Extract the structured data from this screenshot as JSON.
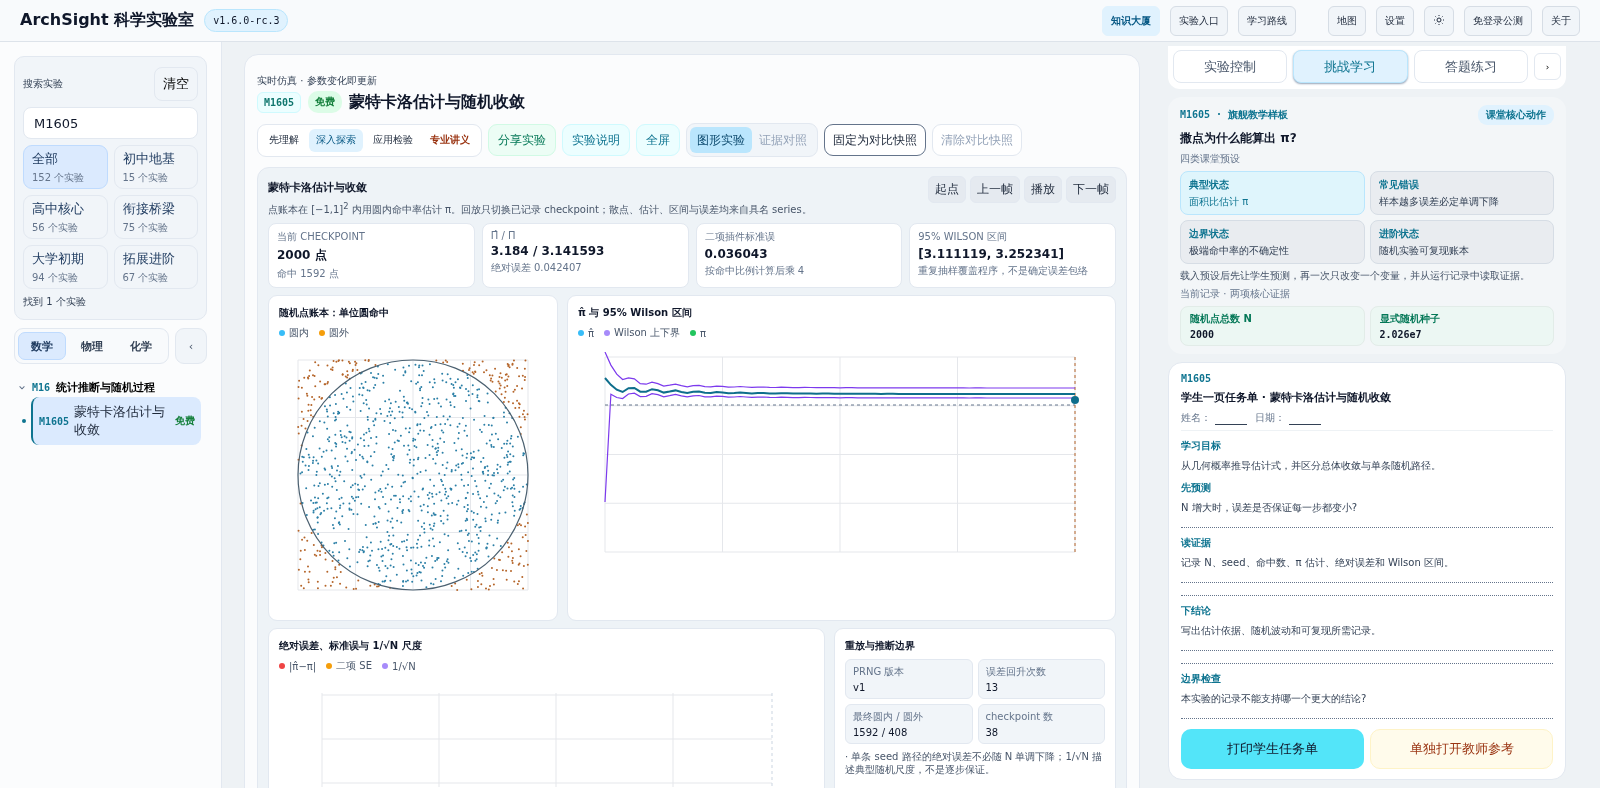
{
  "header": {
    "brand": "ArchSight 科学实验室",
    "version": "v1.6.0-rc.3",
    "nav": [
      {
        "label": "知识大厦",
        "selected": true
      },
      {
        "label": "实验入口",
        "selected": false
      },
      {
        "label": "学习路线",
        "selected": false
      }
    ],
    "tools": [
      {
        "kind": "text",
        "label": "地图"
      },
      {
        "kind": "text",
        "label": "设置"
      },
      {
        "kind": "theme"
      },
      {
        "kind": "text",
        "label": "免登录公测"
      },
      {
        "kind": "text",
        "label": "关于"
      }
    ]
  },
  "sidebar": {
    "search": {
      "label": "搜索实验",
      "clear": "清空",
      "value": "M1605"
    },
    "levels": [
      {
        "name": "全部",
        "count": "152 个实验",
        "selected": true
      },
      {
        "name": "初中地基",
        "count": "15 个实验",
        "selected": false
      },
      {
        "name": "高中核心",
        "count": "56 个实验",
        "selected": false
      },
      {
        "name": "衔接桥梁",
        "count": "75 个实验",
        "selected": false
      },
      {
        "name": "大学初期",
        "count": "94 个实验",
        "selected": false
      },
      {
        "name": "拓展进阶",
        "count": "67 个实验",
        "selected": false
      }
    ],
    "found": "找到 1 个实验",
    "subjects": [
      {
        "label": "数学",
        "selected": true
      },
      {
        "label": "物理",
        "selected": false
      },
      {
        "label": "化学",
        "selected": false
      }
    ],
    "collapse": "‹",
    "tree": [
      {
        "code": "M16",
        "title": "统计推断与随机过程",
        "expanded": true,
        "children": [
          {
            "code": "M1605",
            "title": "蒙特卡洛估计与收敛",
            "badge": "免费",
            "selected": true
          }
        ]
      }
    ]
  },
  "main": {
    "subtitle": "实时仿真 · 参数变化即更新",
    "code": "M1605",
    "badge": "免费",
    "title": "蒙特卡洛估计与随机收敛",
    "modes": [
      {
        "label": "先理解",
        "kind": "plain",
        "selected": false
      },
      {
        "label": "深入探索",
        "kind": "plain",
        "selected": true
      },
      {
        "label": "应用检验",
        "kind": "plain",
        "selected": false
      },
      {
        "label": "专业讲义",
        "kind": "pro",
        "selected": false
      }
    ],
    "actions": [
      {
        "label": "分享实验",
        "kind": "share"
      },
      {
        "label": "实验说明",
        "kind": "info"
      },
      {
        "label": "全屏",
        "kind": "info"
      }
    ],
    "views": [
      {
        "label": "图形实验",
        "selected": true
      },
      {
        "label": "证据对照",
        "selected": false
      }
    ],
    "snapshots": [
      {
        "label": "固定为对比快照",
        "disabled": false
      },
      {
        "label": "清除对比快照",
        "disabled": true
      }
    ],
    "sim": {
      "title": "蒙特卡洛估计与收敛",
      "description": "点账本在 [−1,1]$^{2}$ 内用圆内命中率估计 π。回放只切换已记录 checkpoint；散点、估计、区间与误差均来自具名 series。",
      "playback": [
        "起点",
        "上一帧",
        "播放",
        "下一帧"
      ],
      "stats": [
        {
          "label": "当前 CHECKPOINT",
          "value": "2000 点",
          "note": "命中 1592 点"
        },
        {
          "label": "Π̂ / Π",
          "value": "3.184 / 3.141593",
          "note": "绝对误差 0.042407"
        },
        {
          "label": "二项插件标准误",
          "value": "0.036043",
          "note": "按命中比例计算后乘 4"
        },
        {
          "label": "95% WILSON 区间",
          "value": "[3.111119, 3.252341]",
          "note": "重复抽样覆盖程序，不是确定误差包络"
        }
      ],
      "scatter": {
        "title": "随机点账本：单位圆命中",
        "legend": [
          {
            "label": "圆内",
            "color": "#38bdf8"
          },
          {
            "label": "圆外",
            "color": "#f59e0b"
          }
        ]
      },
      "estimate": {
        "title": "π̂ 与 95% Wilson 区间",
        "legend": [
          {
            "label": "π̂",
            "color": "#38bdf8"
          },
          {
            "label": "Wilson 上下界",
            "color": "#a78bfa"
          },
          {
            "label": "π",
            "color": "#22c55e"
          }
        ]
      },
      "error": {
        "title": "绝对误差、标准误与 1/√N 尺度",
        "legend": [
          {
            "label": "|π̂−π|",
            "color": "#ef4444"
          },
          {
            "label": "二项 SE",
            "color": "#f59e0b"
          },
          {
            "label": "1/√N",
            "color": "#a78bfa"
          }
        ]
      },
      "boundary": {
        "title": "重放与推断边界",
        "items": [
          {
            "label": "PRNG 版本",
            "value": "v1"
          },
          {
            "label": "误差回升次数",
            "value": "13"
          },
          {
            "label": "最终圆内 / 圆外",
            "value": "1592 / 408"
          },
          {
            "label": "checkpoint 数",
            "value": "38"
          }
        ],
        "note": "· 单条 seed 路径的绝对误差不必随 N 单调下降；1/√N 描述典型随机尺度，不是逐步保证。"
      }
    }
  },
  "panel": {
    "tabs": [
      {
        "label": "实验控制",
        "selected": false
      },
      {
        "label": "挑战学习",
        "selected": true
      },
      {
        "label": "答题练习",
        "selected": false
      }
    ],
    "next": "›",
    "challenge": {
      "eyebrow": "M1605 · 旗舰教学样板",
      "chip": "课堂核心动作",
      "title": "撒点为什么能算出 π?",
      "presets_label": "四类课堂预设",
      "presets": [
        {
          "label": "典型状态",
          "text": "面积比估计 π",
          "selected": true
        },
        {
          "label": "常见错误",
          "text": "样本越多误差必定单调下降",
          "selected": false
        },
        {
          "label": "边界状态",
          "text": "极端命中率的不确定性",
          "selected": false
        },
        {
          "label": "进阶状态",
          "text": "随机实验可复现账本",
          "selected": false
        }
      ],
      "note": "载入预设后先让学生预测，再一次只改变一个变量，并从运行记录中读取证据。",
      "record_label": "当前记录 · 两项核心证据",
      "records": [
        {
          "label": "随机点总数 N",
          "value": "2000"
        },
        {
          "label": "显式随机种子",
          "value": "2.026e7"
        }
      ]
    },
    "worksheet": {
      "code": "M1605",
      "title": "学生一页任务单 · 蒙特卡洛估计与随机收敛",
      "fields": [
        {
          "label": "姓名："
        },
        {
          "label": "日期："
        }
      ],
      "sections": [
        {
          "heading": "学习目标",
          "text": "从几何概率推导估计式，并区分总体收敛与单条随机路径。",
          "kind": "plain"
        },
        {
          "heading": "先预测",
          "text": "N 增大时，误差是否保证每一步都变小?",
          "kind": "one-line"
        },
        {
          "heading": "读证据",
          "text": "记录 N、seed、命中数、π 估计、绝对误差和 Wilson 区间。",
          "kind": "two-line"
        },
        {
          "heading": "下结论",
          "text": "写出估计依据、随机波动和可复现所需记录。",
          "kind": "two-line"
        },
        {
          "heading": "边界检查",
          "text": "本实验的记录不能支持哪一个更大的结论?",
          "kind": "one-line"
        }
      ],
      "buttons": [
        {
          "label": "打印学生任务单",
          "kind": "primary"
        },
        {
          "label": "单独打开教师参考",
          "kind": "teacher"
        }
      ]
    }
  }
}
